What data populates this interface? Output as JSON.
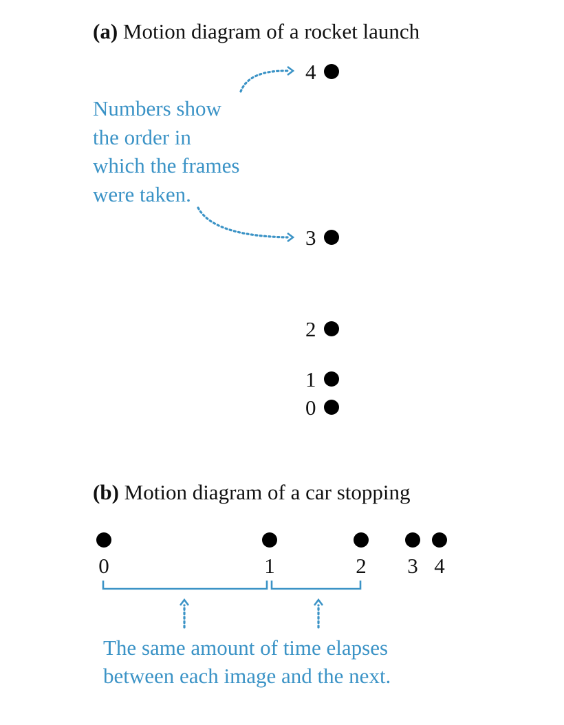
{
  "part_a": {
    "label": "a",
    "title": "Motion diagram of a rocket launch",
    "frames": [
      "0",
      "1",
      "2",
      "3",
      "4"
    ],
    "annotation": [
      "Numbers show",
      "the order in",
      "which the frames",
      "were taken."
    ]
  },
  "part_b": {
    "label": "b",
    "title": "Motion diagram of a car stopping",
    "frames": [
      "0",
      "1",
      "2",
      "3",
      "4"
    ],
    "annotation": [
      "The same amount of time elapses",
      "between each image and the next."
    ]
  },
  "colors": {
    "accent": "#3b93c6",
    "ink": "#000000"
  }
}
